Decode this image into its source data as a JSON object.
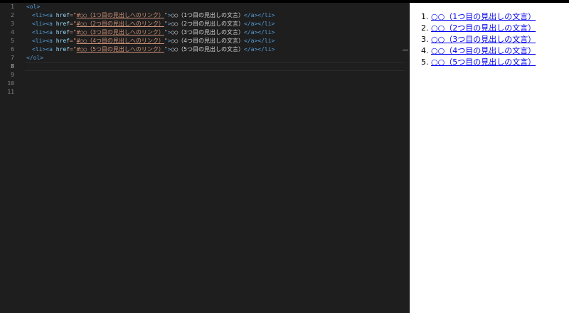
{
  "editor": {
    "line_numbers": [
      "1",
      "2",
      "3",
      "4",
      "5",
      "6",
      "7",
      "8",
      "9",
      "10",
      "11"
    ],
    "active_line": "8",
    "lines": [
      {
        "open_tag": "<ol>"
      },
      {
        "open": "<li><a ",
        "attr": "href",
        "eq": "=\"",
        "href": "#○○（1つ目の見出しへのリンク）",
        "close_quote": "\"",
        "gt": ">",
        "text": "○○（1つ目の見出しの文言）",
        "close": "</a></li>"
      },
      {
        "open": "<li><a ",
        "attr": "href",
        "eq": "=\"",
        "href": "#○○（2つ目の見出しへのリンク）",
        "close_quote": "\"",
        "gt": ">",
        "text": "○○（2つ目の見出しの文言）",
        "close": "</a></li>"
      },
      {
        "open": "<li><a ",
        "attr": "href",
        "eq": "=\"",
        "href": "#○○（3つ目の見出しへのリンク）",
        "close_quote": "\"",
        "gt": ">",
        "text": "○○（3つ目の見出しの文言）",
        "close": "</a></li>"
      },
      {
        "open": "<li><a ",
        "attr": "href",
        "eq": "=\"",
        "href": "#○○（4つ目の見出しへのリンク）",
        "close_quote": "\"",
        "gt": ">",
        "text": "○○（4つ目の見出しの文言）",
        "close": "</a></li>"
      },
      {
        "open": "<li><a ",
        "attr": "href",
        "eq": "=\"",
        "href": "#○○（5つ目の見出しへのリンク）",
        "close_quote": "\"",
        "gt": ">",
        "text": "○○（5つ目の見出しの文言）",
        "close": "</a></li>"
      },
      {
        "close_tag": "</ol>"
      }
    ]
  },
  "preview": {
    "items": [
      "○○（1つ目の見出しの文言）",
      "○○（2つ目の見出しの文言）",
      "○○（3つ目の見出しの文言）",
      "○○（4つ目の見出しの文言）",
      "○○（5つ目の見出しの文言）"
    ]
  },
  "colors": {
    "editor_bg": "#1e1e1e",
    "tag": "#569cd6",
    "attribute": "#9cdcfe",
    "string": "#ce9178",
    "text": "#d4d4d4",
    "line_number": "#858585",
    "link": "#0000ee",
    "preview_bg": "#ffffff"
  }
}
